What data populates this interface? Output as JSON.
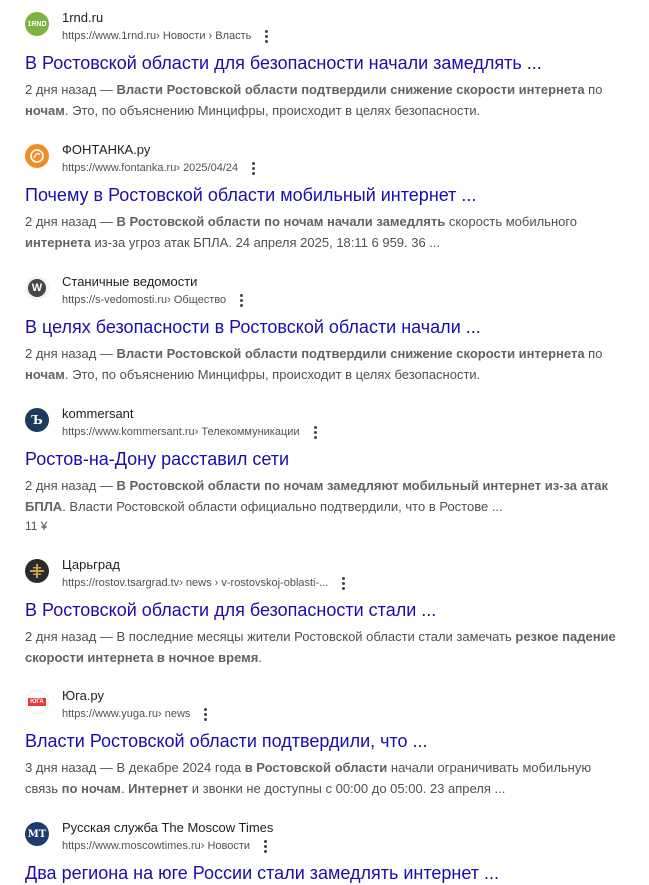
{
  "results": [
    {
      "site": "1rnd.ru",
      "favicon_text": "1RND",
      "url": "https://www.1rnd.ru",
      "path": " › Новости › Власть",
      "title": "В Ростовской области для безопасности начали замедлять ...",
      "snippet": [
        {
          "t": "2 дня назад — ",
          "b": false
        },
        {
          "t": "Власти Ростовской области подтвердили снижение скорости интернета",
          "b": true
        },
        {
          "t": " по ",
          "b": false
        },
        {
          "t": "ночам",
          "b": true
        },
        {
          "t": ". Это, по объяснению Минцифры, происходит в целях безопасности.",
          "b": false
        }
      ]
    },
    {
      "site": "ФОНТАНКА.ру",
      "favicon_text": "",
      "url": "https://www.fontanka.ru",
      "path": " › 2025/04/24",
      "title": "Почему в Ростовской области мобильный интернет ...",
      "snippet": [
        {
          "t": "2 дня назад — ",
          "b": false
        },
        {
          "t": "В Ростовской области по ночам начали замедлять",
          "b": true
        },
        {
          "t": " скорость мобильного ",
          "b": false
        },
        {
          "t": "интернета",
          "b": true
        },
        {
          "t": " из-за угроз атак БПЛА. 24 апреля 2025, 18:11 6 959. 36 ...",
          "b": false
        }
      ]
    },
    {
      "site": "Станичные ведомости",
      "favicon_text": "W",
      "url": "https://s-vedomosti.ru",
      "path": " › Общество",
      "title": "В целях безопасности в Ростовской области начали ...",
      "snippet": [
        {
          "t": "2 дня назад — ",
          "b": false
        },
        {
          "t": "Власти Ростовской области подтвердили снижение скорости интернета",
          "b": true
        },
        {
          "t": " по ",
          "b": false
        },
        {
          "t": "ночам",
          "b": true
        },
        {
          "t": ". Это, по объяснению Минцифры, происходит в целях безопасности.",
          "b": false
        }
      ]
    },
    {
      "site": "kommersant",
      "favicon_text": "Ъ",
      "url": "https://www.kommersant.ru",
      "path": " › Телекоммуникации",
      "title": "Ростов-на-Дону расставил сети",
      "snippet": [
        {
          "t": "2 дня назад — ",
          "b": false
        },
        {
          "t": "В Ростовской области по ночам замедляют мобильный интернет из-за атак БПЛА",
          "b": true
        },
        {
          "t": ". Власти Ростовской области официально подтвердили, что в Ростове ...",
          "b": false
        }
      ],
      "extra": "11 ¥"
    },
    {
      "site": "Царьград",
      "favicon_text": "",
      "url": "https://rostov.tsargrad.tv",
      "path": " › news › v-rostovskoj-oblasti-...",
      "title": "В Ростовской области для безопасности стали ...",
      "snippet": [
        {
          "t": "2 дня назад — В последние месяцы жители Ростовской области стали замечать ",
          "b": false
        },
        {
          "t": "резкое падение скорости интернета в ночное время",
          "b": true
        },
        {
          "t": ".",
          "b": false
        }
      ]
    },
    {
      "site": "Юга.ру",
      "favicon_text": "ЮГА",
      "url": "https://www.yuga.ru",
      "path": " › news",
      "title": "Власти Ростовской области подтвердили, что ...",
      "snippet": [
        {
          "t": "3 дня назад — В декабре 2024 года ",
          "b": false
        },
        {
          "t": "в Ростовской области",
          "b": true
        },
        {
          "t": " начали ограничивать мобильную связь ",
          "b": false
        },
        {
          "t": "по ночам",
          "b": true
        },
        {
          "t": ". ",
          "b": false
        },
        {
          "t": "Интернет",
          "b": true
        },
        {
          "t": " и звонки не доступны с 00:00 до 05:00. 23 апреля ...",
          "b": false
        }
      ]
    },
    {
      "site": "Русская служба The Moscow Times",
      "favicon_text": "MT",
      "url": "https://www.moscowtimes.ru",
      "path": " › Новости",
      "title": "Два региона на юге России стали замедлять интернет ...",
      "snippet": []
    }
  ]
}
